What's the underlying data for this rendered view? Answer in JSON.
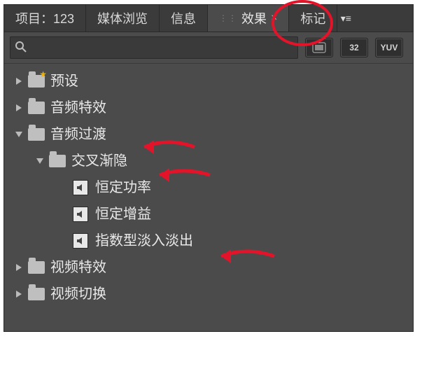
{
  "tabs": {
    "project_prefix": "项目：",
    "project_name": "123",
    "media_browser": "媒体浏览",
    "info": "信息",
    "effects": "效果",
    "markers": "标记"
  },
  "search": {
    "placeholder": ""
  },
  "chips": {
    "fx": "",
    "num": "32",
    "yuv": "YUV"
  },
  "tree": {
    "presets": "预设",
    "audio_effects": "音频特效",
    "audio_transitions": "音频过渡",
    "crossfade": "交叉渐隐",
    "constant_power": "恒定功率",
    "constant_gain": "恒定增益",
    "exponential_fade": "指数型淡入淡出",
    "video_effects": "视频特效",
    "video_transitions": "视频切换"
  }
}
